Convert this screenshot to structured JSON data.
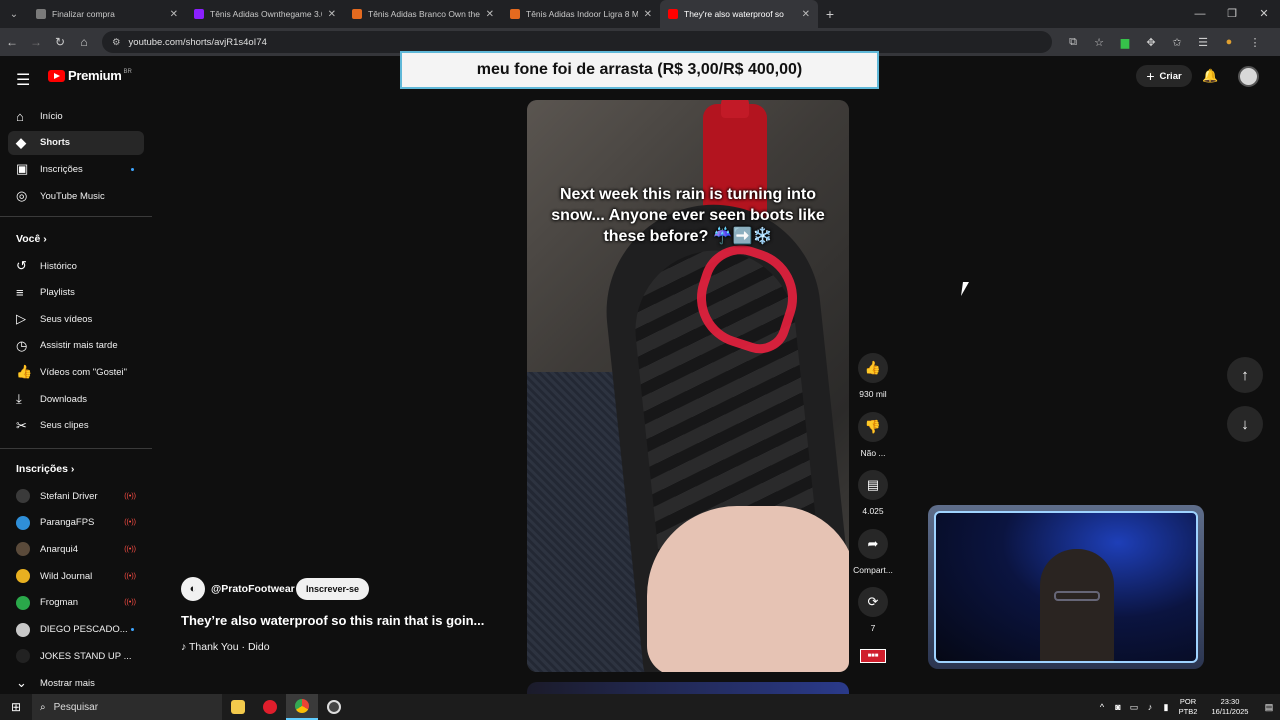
{
  "browser": {
    "tabs": [
      {
        "title": "Finalizar compra",
        "color": "#7a7a7a",
        "active": false
      },
      {
        "title": "Tênis Adidas Ownthegame 3.0 |",
        "color": "#8b20ff",
        "active": false
      },
      {
        "title": "Tênis Adidas Branco Own the G",
        "color": "#e46a1f",
        "active": false
      },
      {
        "title": "Tênis Adidas Indoor Ligra 8 Ma",
        "color": "#e46a1f",
        "active": false
      },
      {
        "title": "They're also waterproof so",
        "color": "#ff0000",
        "active": true
      }
    ],
    "url": "youtube.com/shorts/avjR1s4oI74"
  },
  "header": {
    "logo_text": "Premium",
    "logo_region": "BR",
    "create_label": "Criar"
  },
  "sidebar": {
    "main": [
      {
        "label": "Início",
        "icon": "home-icon",
        "glyph": "⌂"
      },
      {
        "label": "Shorts",
        "icon": "shorts-icon",
        "glyph": "◆"
      },
      {
        "label": "Inscrições",
        "icon": "subscriptions-icon",
        "glyph": "▣"
      },
      {
        "label": "YouTube Music",
        "icon": "music-icon",
        "glyph": "◎"
      }
    ],
    "you_title": "Você",
    "you": [
      {
        "label": "Histórico",
        "icon": "history-icon",
        "glyph": "↺"
      },
      {
        "label": "Playlists",
        "icon": "playlists-icon",
        "glyph": "≡"
      },
      {
        "label": "Seus vídeos",
        "icon": "your-videos-icon",
        "glyph": "▷"
      },
      {
        "label": "Assistir mais tarde",
        "icon": "watch-later-icon",
        "glyph": "◷"
      },
      {
        "label": "Vídeos com \"Gostei\"",
        "icon": "liked-icon",
        "glyph": "👍"
      },
      {
        "label": "Downloads",
        "icon": "download-icon",
        "glyph": "⤓"
      },
      {
        "label": "Seus clipes",
        "icon": "clips-icon",
        "glyph": "✂"
      }
    ],
    "subs_title": "Inscrições",
    "subs": [
      {
        "label": "Stefani Driver",
        "avatar": "#3a3a3a",
        "status": "live"
      },
      {
        "label": "ParangaFPS",
        "avatar": "#2f8fd8",
        "status": "live"
      },
      {
        "label": "Anarqui4",
        "avatar": "#5a4a3a",
        "status": "live"
      },
      {
        "label": "Wild Journal",
        "avatar": "#e8b020",
        "status": "live"
      },
      {
        "label": "Frogman",
        "avatar": "#2aa84a",
        "status": "live"
      },
      {
        "label": "DIEGO PESCADO...",
        "avatar": "#c8c8c8",
        "status": "dot"
      },
      {
        "label": "JOKES STAND UP ...",
        "avatar": "#222222",
        "status": ""
      }
    ],
    "show_more": "Mostrar mais"
  },
  "banner": "meu fone foi de arrasta (R$ 3,00/R$ 400,00)",
  "short": {
    "caption": "Next week this rain is turning into snow... Anyone ever seen boots like these before? ☔➡️❄️",
    "channel": "@PratoFootwear",
    "subscribe": "Inscrever-se",
    "title": "They’re also waterproof so this rain that is goin...",
    "sound": "♪ Thank You · Dido"
  },
  "actions": [
    {
      "name": "like-button",
      "icon": "thumbs-up-icon",
      "glyph": "👍",
      "label": "930 mil"
    },
    {
      "name": "dislike-button",
      "icon": "thumbs-down-icon",
      "glyph": "👎",
      "label": "Não ..."
    },
    {
      "name": "comments-button",
      "icon": "comment-icon",
      "glyph": "▤",
      "label": "4.025"
    },
    {
      "name": "share-button",
      "icon": "share-icon",
      "glyph": "➦",
      "label": "Compart..."
    },
    {
      "name": "remix-button",
      "icon": "remix-icon",
      "glyph": "⟳",
      "label": "7"
    }
  ],
  "taskbar": {
    "search": "Pesquisar",
    "lang1": "POR",
    "lang2": "PTB2",
    "time": "23:30",
    "date": "16/11/2025"
  }
}
